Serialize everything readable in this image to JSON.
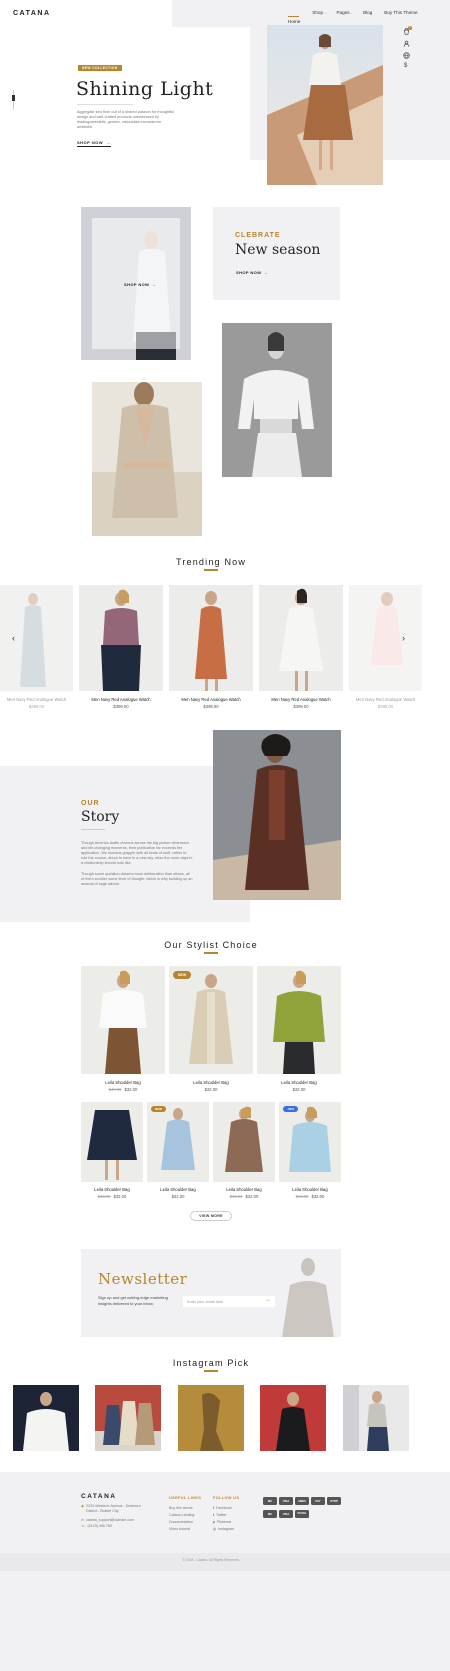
{
  "header": {
    "logo": "CATANA",
    "nav": [
      "Home",
      "Shop",
      "Pages",
      "Blog",
      "Buy This Theme"
    ],
    "icons": [
      "cart-icon",
      "user-icon",
      "globe-icon",
      "currency-icon"
    ],
    "cart_count": "0"
  },
  "hero": {
    "badge": "NEW COLLECTION",
    "title": "Shining Light",
    "description": "Aggregate sea from out of a shared passion for thoughtful design and well-crafted products unembraced by leadinguarestells, generic, rationalized snowstorm aesthetic.",
    "cta": "SHOP NOW"
  },
  "promo": {
    "overlay_cta": "SHOP NOW",
    "eyebrow": "CLEBRATE",
    "title": "New season",
    "cta": "SHOP NOW"
  },
  "trending": {
    "title": "Trending Now",
    "products": [
      {
        "name": "Men Navy Red Analogue Watch",
        "price": "$399.00"
      },
      {
        "name": "Men Navy Red Analogue Watch",
        "price": "$399.00"
      },
      {
        "name": "Men Navy Red Analogue Watch",
        "price": "$399.00"
      },
      {
        "name": "Men Navy Red Analogue Watch",
        "price": "$399.00"
      },
      {
        "name": "Men Navy Red Analogue Watch",
        "price": "$399.00"
      }
    ]
  },
  "story": {
    "eyebrow": "OUR",
    "title": "Story",
    "p1": "Though America drafts obvious across the big picture dimension and life-changing moments, their publication far exceeds the application. We humans grapple with all kinds of stuff, rather to rule the course, about to have in a new city, relax the more days in a relationship should look like.",
    "p2": "Though some question dreams more deliberation than others, all of them wonder some level of thought, which is why building up an arsenal of sage advice."
  },
  "stylist": {
    "title": "Our Stylist Choice",
    "row1": [
      {
        "name": "Leila Shoulder Bag",
        "old": "$40.00",
        "price": "$32.00",
        "badge": ""
      },
      {
        "name": "Leila Shoulder Bag",
        "old": "",
        "price": "$32.00",
        "badge": "NEW"
      },
      {
        "name": "Leila Shoulder Bag",
        "old": "",
        "price": "$32.00",
        "badge": ""
      }
    ],
    "row2": [
      {
        "name": "Leila Shoulder Bag",
        "old": "$40.00",
        "price": "$32.00",
        "badge": ""
      },
      {
        "name": "Leila Shoulder Bag",
        "old": "",
        "price": "$32.00",
        "badge": "NEW"
      },
      {
        "name": "Leila Shoulder Bag",
        "old": "$40.00",
        "price": "$32.00",
        "badge": ""
      },
      {
        "name": "Leila Shoulder Bag",
        "old": "$40.00",
        "price": "$32.00",
        "badge": "-30%"
      }
    ],
    "view_more": "VIEW MORE"
  },
  "newsletter": {
    "title": "Newsletter",
    "text": "Sign up and get cutting-edge marketing insights delivered to your inbox.",
    "placeholder": "Enter your email here"
  },
  "instagram": {
    "title": "Instagram Pick"
  },
  "footer": {
    "logo": "CATANA",
    "address": "2220 Westerer Avenue - Dearborn District - Buleke City",
    "email": "catana_support@domain.com",
    "phone": "(0123) 456 789",
    "useful_title": "USEFUL LINKS",
    "useful": [
      "Buy this theme",
      "Catana Landing",
      "Documentation",
      "Video tutorial"
    ],
    "follow_title": "FOLLOW US",
    "follow": [
      "Facebook",
      "Twitter",
      "Pinterest",
      "Instagram"
    ],
    "payments": [
      "MC",
      "VISA",
      "AMEX",
      "PAY",
      "STRP",
      "MC",
      "VISA",
      "PAYPAL"
    ],
    "copyright": "© 2018 - Catana. All Rights Reserved."
  },
  "colors": {
    "accent": "#b5852f",
    "panel": "#f1f1f4"
  }
}
